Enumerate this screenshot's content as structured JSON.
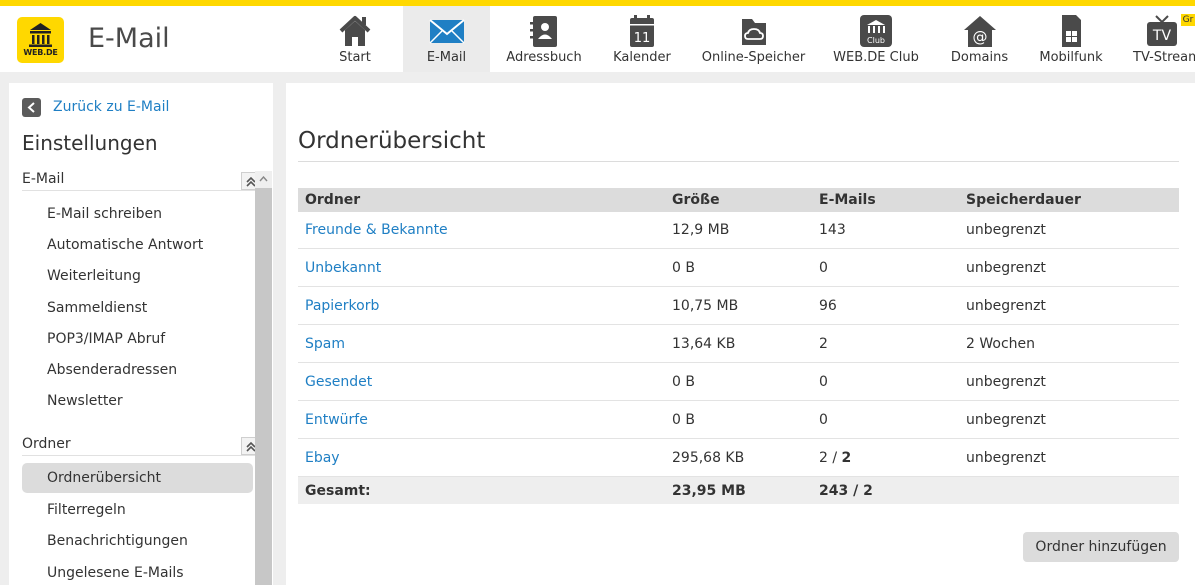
{
  "brand": {
    "logo_text": "WEB.DE",
    "app_title": "E-Mail",
    "accent": "#ffd800",
    "link_color": "#1f7fc4"
  },
  "nav": [
    {
      "label": "Start",
      "icon": "house-icon"
    },
    {
      "label": "E-Mail",
      "icon": "envelope-icon",
      "active": true
    },
    {
      "label": "Adressbuch",
      "icon": "address-book-icon"
    },
    {
      "label": "Kalender",
      "icon": "calendar-icon",
      "calendar_day": "11"
    },
    {
      "label": "Online-Speicher",
      "icon": "cloud-icon"
    },
    {
      "label": "WEB.DE Club",
      "icon": "club-icon",
      "icon_text": "Club"
    },
    {
      "label": "Domains",
      "icon": "at-house-icon",
      "icon_text": "@"
    },
    {
      "label": "Mobilfunk",
      "icon": "sim-card-icon"
    },
    {
      "label": "TV-Stream",
      "icon": "tv-icon",
      "icon_text": "TV",
      "badge": "Gr"
    }
  ],
  "sidebar": {
    "back_label": "Zurück zu E-Mail",
    "title": "Einstellungen",
    "sections": [
      {
        "label": "E-Mail",
        "items": [
          "E-Mail schreiben",
          "Automatische Antwort",
          "Weiterleitung",
          "Sammeldienst",
          "POP3/IMAP Abruf",
          "Absenderadressen",
          "Newsletter"
        ]
      },
      {
        "label": "Ordner",
        "items": [
          "Ordnerübersicht",
          "Filterregeln",
          "Benachrichtigungen",
          "Ungelesene E-Mails"
        ],
        "active_item": "Ordnerübersicht"
      }
    ]
  },
  "main": {
    "title": "Ordnerübersicht",
    "columns": [
      "Ordner",
      "Größe",
      "E-Mails",
      "Speicherdauer"
    ],
    "rows": [
      {
        "name": "Freunde & Bekannte",
        "size": "12,9 MB",
        "emails": "143",
        "retention": "unbegrenzt"
      },
      {
        "name": "Unbekannt",
        "size": "0 B",
        "emails": "0",
        "retention": "unbegrenzt"
      },
      {
        "name": "Papierkorb",
        "size": "10,75 MB",
        "emails": "96",
        "retention": "unbegrenzt"
      },
      {
        "name": "Spam",
        "size": "13,64 KB",
        "emails": "2",
        "retention": "2 Wochen"
      },
      {
        "name": "Gesendet",
        "size": "0 B",
        "emails": "0",
        "retention": "unbegrenzt"
      },
      {
        "name": "Entwürfe",
        "size": "0 B",
        "emails": "0",
        "retention": "unbegrenzt"
      },
      {
        "name": "Ebay",
        "size": "295,68 KB",
        "emails": "2",
        "emails_unread": "2",
        "retention": "unbegrenzt"
      }
    ],
    "total": {
      "label": "Gesamt:",
      "size": "23,95 MB",
      "emails": "243 / 2"
    },
    "add_button": "Ordner hinzufügen"
  }
}
